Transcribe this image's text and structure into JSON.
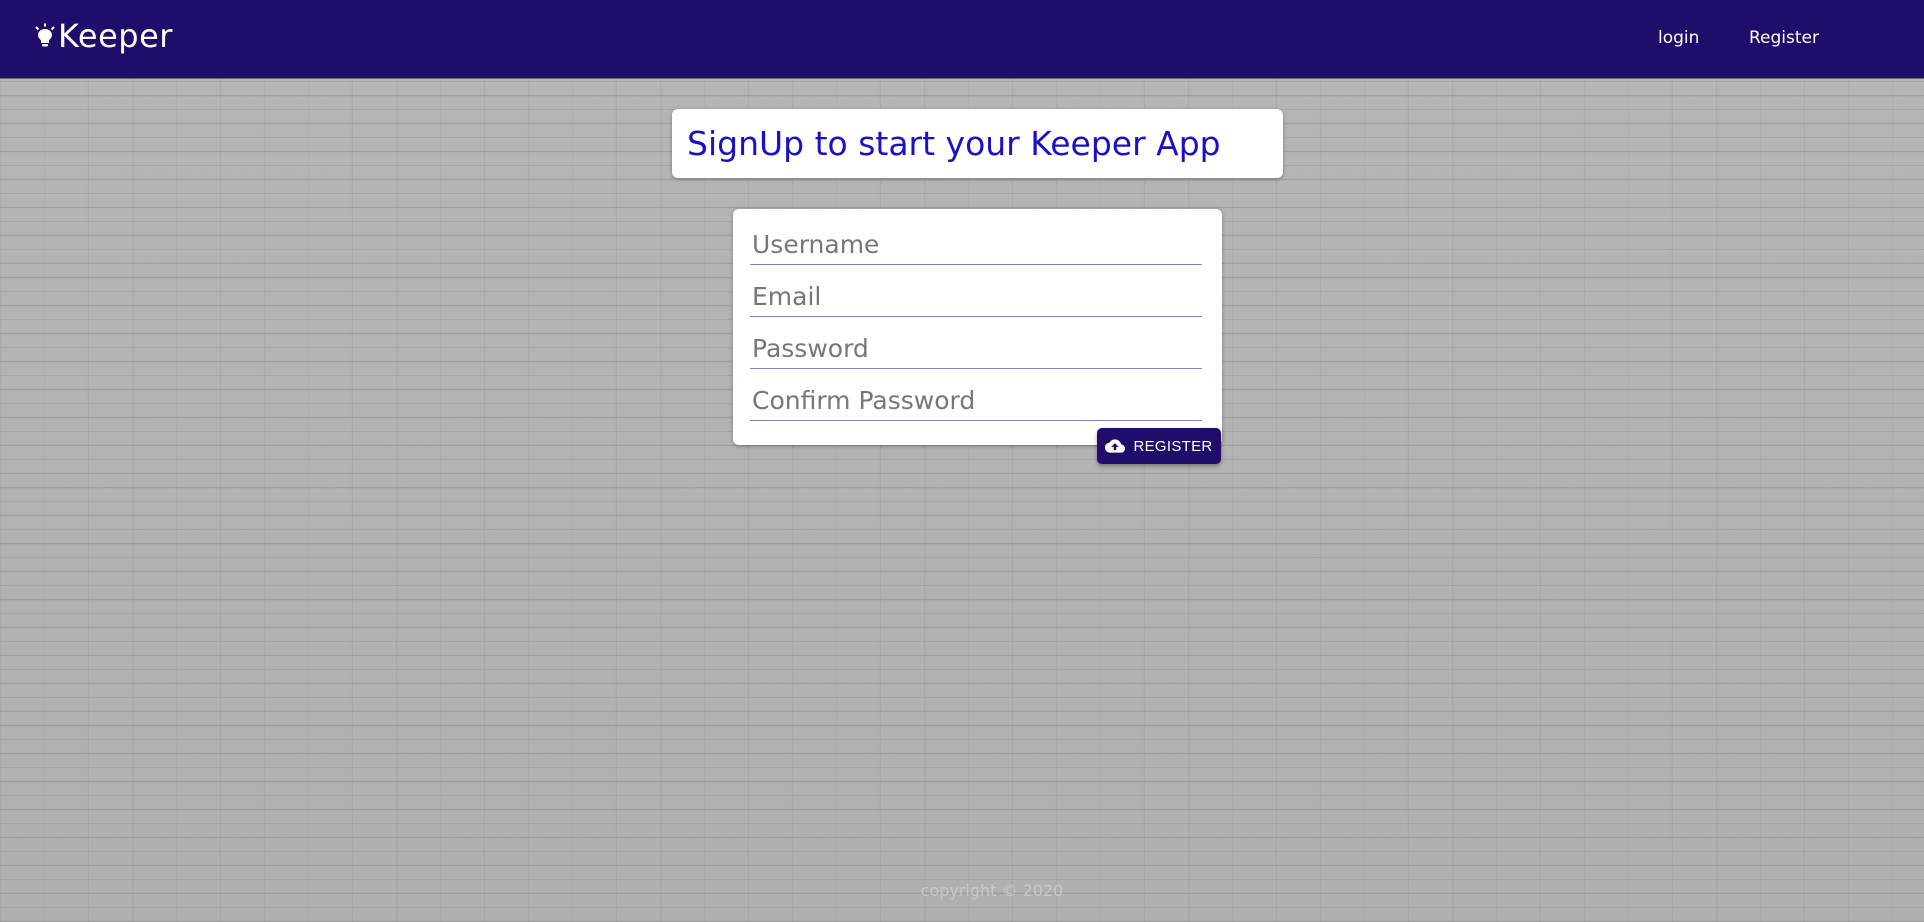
{
  "navbar": {
    "brand_icon": "lightbulb-icon",
    "brand_name": "Keeper",
    "links": [
      {
        "label": "login"
      },
      {
        "label": "Register"
      }
    ],
    "background_color": "#1f0c6b"
  },
  "title_card": {
    "heading": "SignUp to start your Keeper App",
    "heading_color": "#1a10c8"
  },
  "form": {
    "username": {
      "placeholder": "Username",
      "value": ""
    },
    "email": {
      "placeholder": "Email",
      "value": ""
    },
    "password": {
      "placeholder": "Password",
      "value": ""
    },
    "confirm_password": {
      "placeholder": "Confirm Password",
      "value": ""
    },
    "submit": {
      "label": "REGISTER",
      "icon": "cloud-upload-icon"
    }
  },
  "footer": {
    "text": "copyright © 2020"
  }
}
